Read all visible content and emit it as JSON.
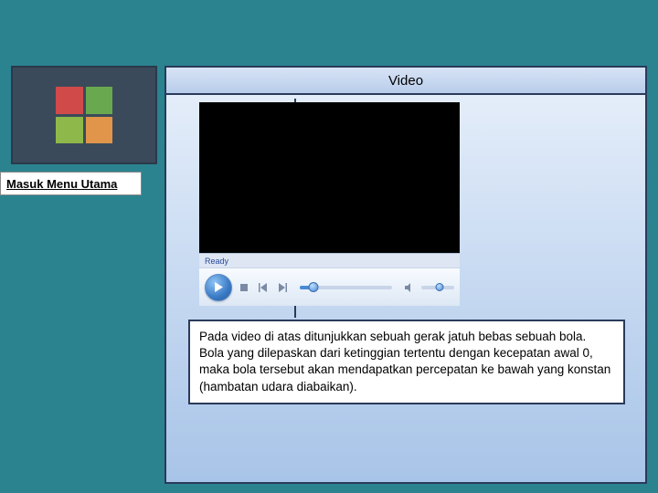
{
  "sidebar": {
    "logo_tiles": [
      "red",
      "green",
      "lime",
      "orange"
    ],
    "menu_button_label": "Masuk Menu Utama"
  },
  "panel": {
    "title": "Video",
    "player": {
      "status": "Ready",
      "icons": {
        "play": "play-icon",
        "stop": "stop-icon",
        "prev": "prev-icon",
        "next": "next-icon",
        "speaker": "speaker-icon"
      }
    },
    "description": "Pada video di atas ditunjukkan sebuah gerak jatuh bebas sebuah bola. Bola yang dilepaskan dari ketinggian tertentu dengan kecepatan awal 0, maka bola tersebut akan mendapatkan percepatan ke bawah yang konstan (hambatan udara diabaikan)."
  }
}
